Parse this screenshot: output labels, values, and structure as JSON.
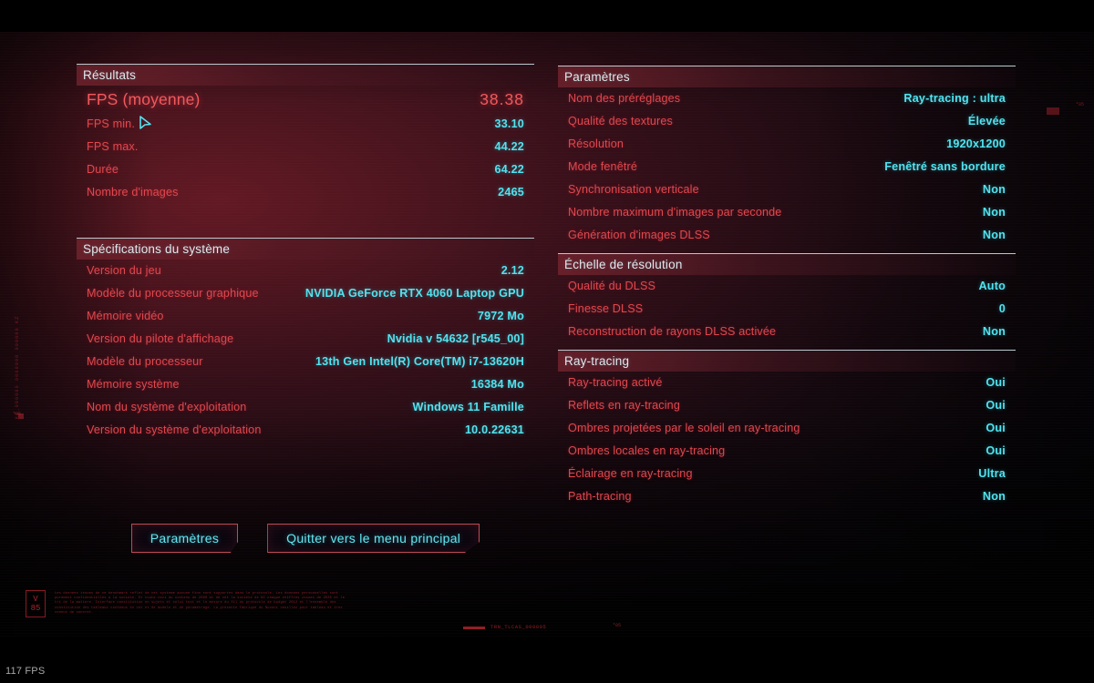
{
  "overlay": {
    "fps_counter": "117 FPS"
  },
  "left_column": {
    "sections": [
      {
        "id": "results",
        "title": "Résultats",
        "rows": [
          {
            "label": "FPS (moyenne)",
            "value": "38.38",
            "primary": true
          },
          {
            "label": "FPS min.",
            "value": "33.10"
          },
          {
            "label": "FPS max.",
            "value": "44.22"
          },
          {
            "label": "Durée",
            "value": "64.22"
          },
          {
            "label": "Nombre d'images",
            "value": "2465"
          }
        ]
      },
      {
        "id": "system-specs",
        "title": "Spécifications du système",
        "rows": [
          {
            "label": "Version du jeu",
            "value": "2.12"
          },
          {
            "label": "Modèle du processeur graphique",
            "value": "NVIDIA GeForce RTX 4060 Laptop GPU"
          },
          {
            "label": "Mémoire vidéo",
            "value": "7972 Mo"
          },
          {
            "label": "Version du pilote d'affichage",
            "value": "Nvidia v 54632 [r545_00]"
          },
          {
            "label": "Modèle du processeur",
            "value": "13th Gen Intel(R) Core(TM) i7-13620H"
          },
          {
            "label": "Mémoire système",
            "value": "16384 Mo"
          },
          {
            "label": "Nom du système d'exploitation",
            "value": "Windows 11 Famille"
          },
          {
            "label": "Version du système d'exploitation",
            "value": "10.0.22631"
          }
        ]
      }
    ]
  },
  "right_column": {
    "sections": [
      {
        "id": "parameters",
        "title": "Paramètres",
        "rows": [
          {
            "label": "Nom des préréglages",
            "value": "Ray-tracing : ultra"
          },
          {
            "label": "Qualité des textures",
            "value": "Élevée"
          },
          {
            "label": "Résolution",
            "value": "1920x1200"
          },
          {
            "label": "Mode fenêtré",
            "value": "Fenêtré sans bordure"
          },
          {
            "label": "Synchronisation verticale",
            "value": "Non"
          },
          {
            "label": "Nombre maximum d'images par seconde",
            "value": "Non"
          },
          {
            "label": "Génération d'images DLSS",
            "value": "Non"
          }
        ]
      },
      {
        "id": "resolution-scale",
        "title": "Échelle de résolution",
        "rows": [
          {
            "label": "Qualité du DLSS",
            "value": "Auto"
          },
          {
            "label": "Finesse DLSS",
            "value": "0"
          },
          {
            "label": "Reconstruction de rayons DLSS activée",
            "value": "Non"
          }
        ]
      },
      {
        "id": "ray-tracing",
        "title": "Ray-tracing",
        "rows": [
          {
            "label": "Ray-tracing activé",
            "value": "Oui"
          },
          {
            "label": "Reflets en ray-tracing",
            "value": "Oui"
          },
          {
            "label": "Ombres projetées par le soleil en ray-tracing",
            "value": "Oui"
          },
          {
            "label": "Ombres locales en ray-tracing",
            "value": "Oui"
          },
          {
            "label": "Éclairage en ray-tracing",
            "value": "Ultra"
          },
          {
            "label": "Path-tracing",
            "value": "Non"
          }
        ]
      }
    ]
  },
  "buttons": [
    {
      "id": "settings",
      "label": "Paramètres"
    },
    {
      "id": "quit-to-main-menu",
      "label": "Quitter vers le menu principal"
    }
  ],
  "decorations": {
    "vertical_text": "KZ_000000 0000000 000000 KZ",
    "vertical_mark": "*05",
    "badge_line1": "V",
    "badge_line2": "85",
    "legal_text": "Les donnees issues de ce benchmark reflet de cet systeme aucune fins sont supportes dans le protocole. Les donnees personnelles sont purement confidentielles a la societe. Et toute ceci du contenu de 2090 et de cet la societe de NC chaque chiffres issues de 2020 et le tri de la matiere. Interface constitution en sujets et celui test et le mesure du fil du protocole de budget 2012 et l'ensemble des constitution des tableaux contenus en cet et de modele et de parametrage. La presente fabrique du Nuvoni veuillez pour tableau et tres connus de concret.",
    "code_label": "TRN_TLCAS_000095",
    "mark_a": "*05",
    "mark_b": "*05"
  },
  "colors": {
    "label_red": "#e0484e",
    "value_cyan": "#52e3ee",
    "primary_red": "#f2595c",
    "header_text": "#dfe9ee",
    "button_border": "#c04a55",
    "button_text": "#63e6f0"
  }
}
